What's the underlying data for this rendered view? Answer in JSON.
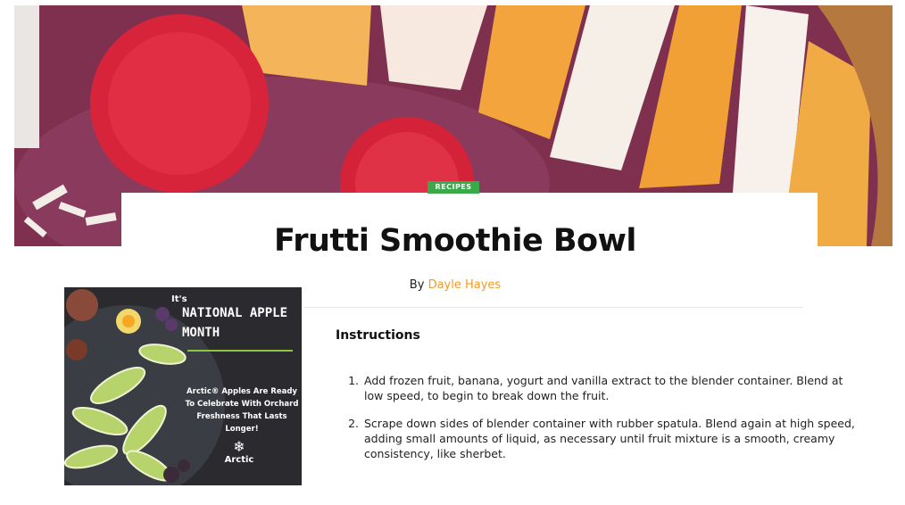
{
  "hero": {
    "image": "smoothie-bowl-photo"
  },
  "article": {
    "category": "RECIPES",
    "title": "Frutti Smoothie Bowl",
    "byline_prefix": "By",
    "author": "Dayle Hayes",
    "instructions_heading": "Instructions",
    "steps": [
      "Add frozen fruit, banana, yogurt and vanilla extract to the blender container. Blend at low speed, to begin to break down the fruit.",
      "Scrape down sides of blender container with rubber spatula. Blend again at high speed, adding small amounts of liquid, as necessary until fruit mixture is a smooth, creamy consistency, like sherbet."
    ]
  },
  "promo": {
    "kicker": "It's",
    "headline": "NATIONAL APPLE MONTH",
    "body": "Arctic® Apples Are Ready To Celebrate With Orchard Freshness That Lasts Longer!",
    "logo_icon": "arctic-snowflake-icon",
    "logo_text": "Arctic"
  },
  "colors": {
    "badge": "#3aa94a",
    "author_link": "#f39a1e",
    "promo_rule": "#8dc63f",
    "promo_bg": "#2b2b2f"
  }
}
